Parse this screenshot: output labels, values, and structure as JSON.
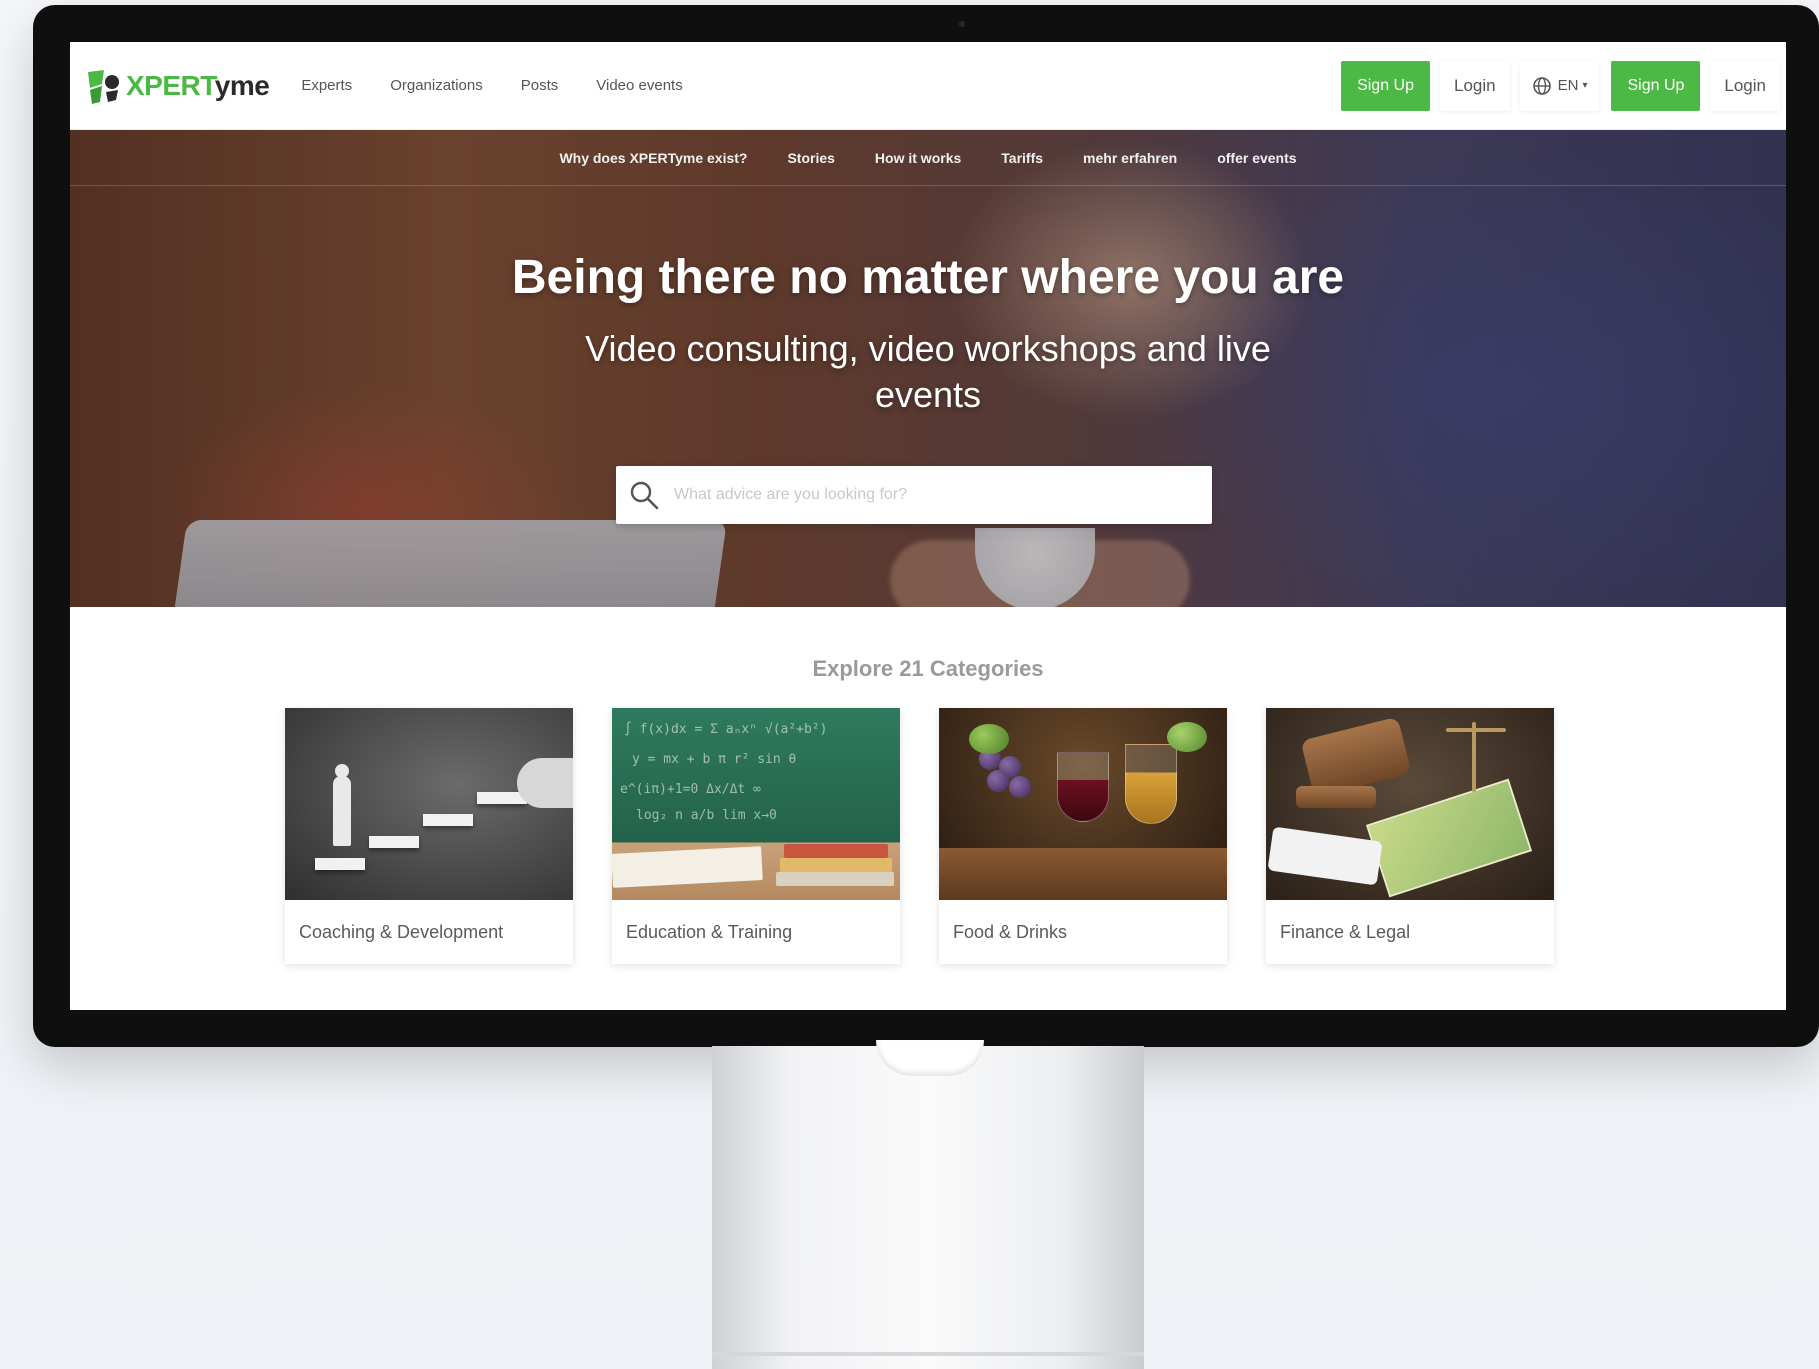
{
  "brand": {
    "logo_part1": "XPERT",
    "logo_part2": "yme",
    "accent_color": "#4cb944"
  },
  "topnav": {
    "links": [
      "Experts",
      "Organizations",
      "Posts",
      "Video events"
    ],
    "signup_label": "Sign Up",
    "login_label": "Login",
    "language": "EN",
    "signup_label_2": "Sign Up",
    "login_label_2": "Login"
  },
  "hero": {
    "subnav": [
      "Why does XPERTyme exist?",
      "Stories",
      "How it works",
      "Tariffs",
      "mehr erfahren",
      "offer events"
    ],
    "title": "Being there no matter where you are",
    "subtitle": "Video consulting, video workshops and live events",
    "search": {
      "placeholder": "What advice are you looking for?",
      "value": ""
    }
  },
  "categories": {
    "heading": "Explore 21 Categories",
    "items": [
      {
        "label": "Coaching & Development",
        "image": "coaching-stairs-image"
      },
      {
        "label": "Education & Training",
        "image": "chalkboard-books-image"
      },
      {
        "label": "Food & Drinks",
        "image": "wine-grapes-image"
      },
      {
        "label": "Finance & Legal",
        "image": "gavel-money-image"
      }
    ]
  },
  "icons": {
    "logo": "xpertyme-logo-icon",
    "language": "globe-icon",
    "search": "search-icon"
  }
}
